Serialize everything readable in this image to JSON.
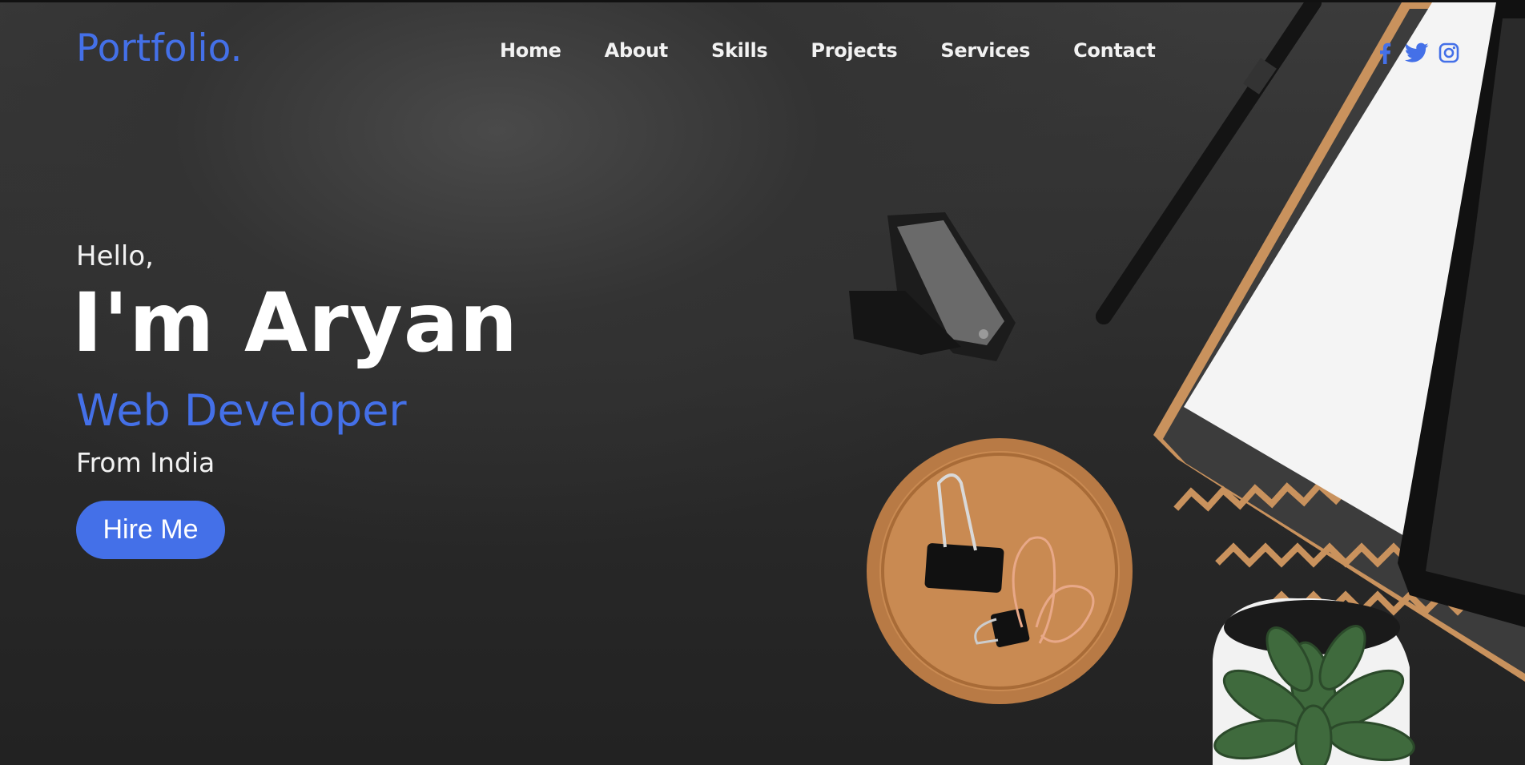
{
  "navbar": {
    "logo": "Portfolio.",
    "links": [
      "Home",
      "About",
      "Skills",
      "Projects",
      "Services",
      "Contact"
    ],
    "social_icons": [
      "facebook-icon",
      "twitter-icon",
      "instagram-icon"
    ]
  },
  "hero": {
    "greeting": "Hello,",
    "name": "I'm Aryan",
    "role": "Web Developer",
    "origin": "From India",
    "cta": "Hire Me"
  },
  "colors": {
    "accent": "#4470e8",
    "background": "#2c2c2c",
    "text": "#f2f2f2"
  }
}
